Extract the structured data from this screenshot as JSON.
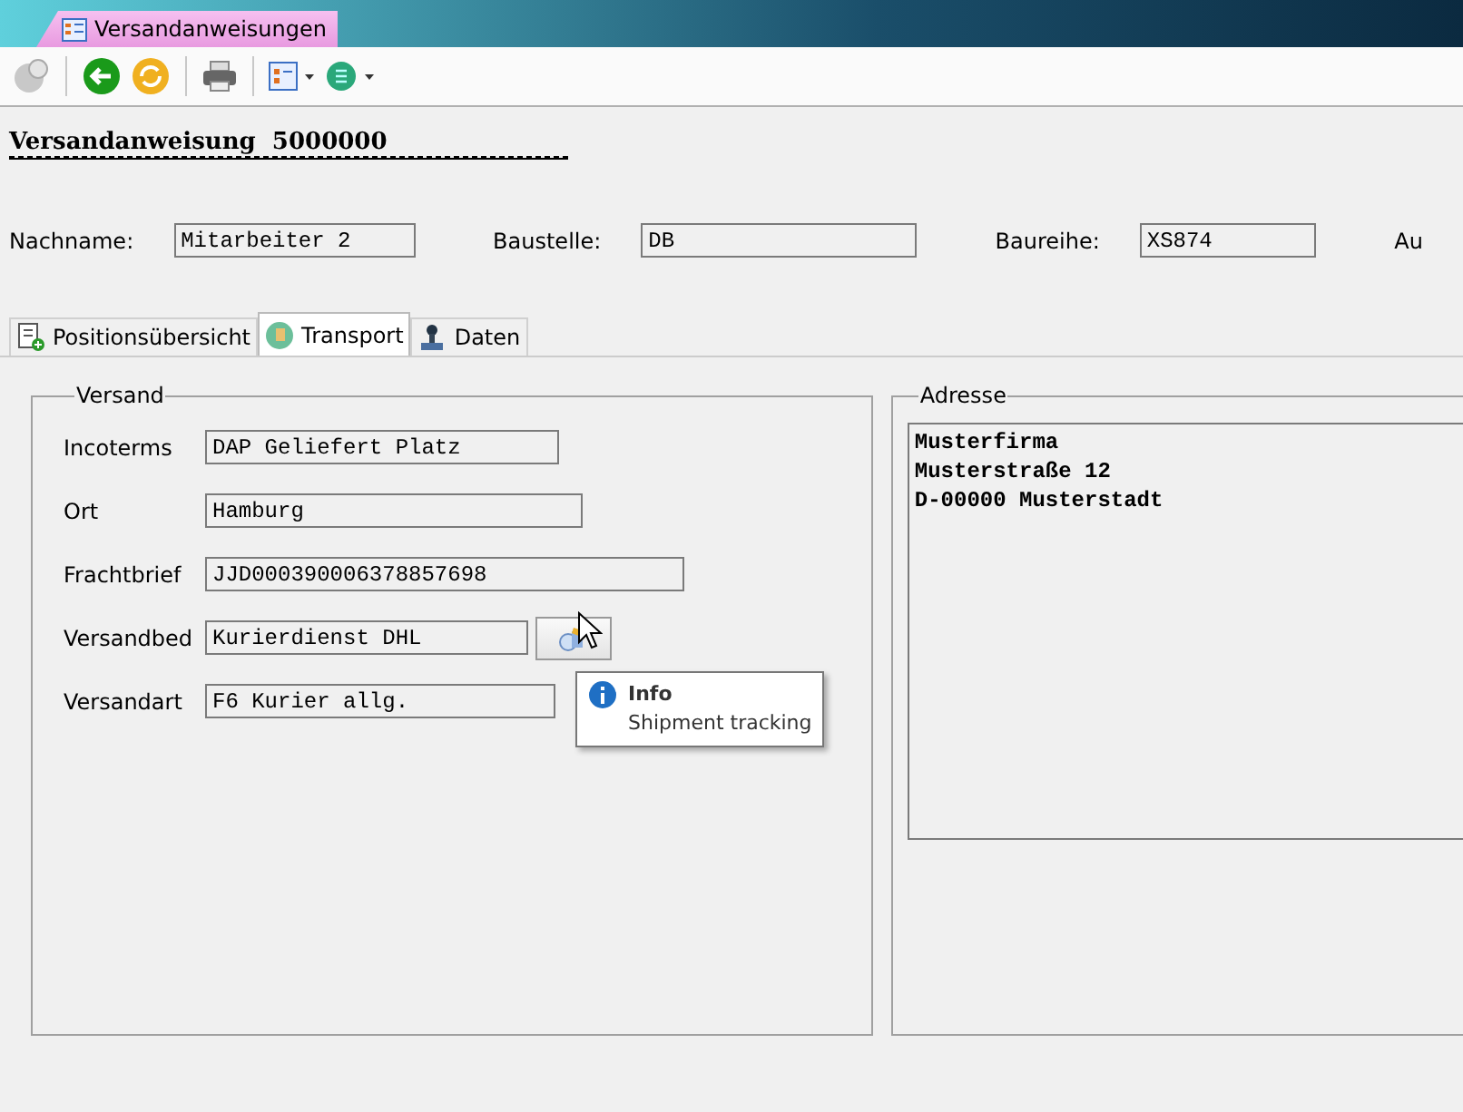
{
  "document_tab": {
    "title": "Versandanweisungen"
  },
  "title": {
    "label": "Versandanweisung",
    "number": "5000000"
  },
  "header_fields": [
    {
      "label": "Nachname:",
      "value": "Mitarbeiter 2"
    },
    {
      "label": "Baustelle:",
      "value": "DB"
    },
    {
      "label": "Baureihe:",
      "value": "XS874"
    },
    {
      "label": "Au"
    }
  ],
  "tabs": [
    {
      "label": "Positionsübersicht",
      "selected": false
    },
    {
      "label": "Transport",
      "selected": true
    },
    {
      "label": "Daten",
      "selected": false
    }
  ],
  "versand": {
    "title": "Versand",
    "fields": [
      {
        "label": "Incoterms",
        "value": "DAP Geliefert Platz"
      },
      {
        "label": "Ort",
        "value": "Hamburg"
      },
      {
        "label": "Frachtbrief",
        "value": "JJD000390006378857698"
      },
      {
        "label": "Versandbed",
        "value": "Kurierdienst DHL"
      },
      {
        "label": "Versandart",
        "value": "F6 Kurier allg."
      }
    ]
  },
  "tooltip": {
    "title": "Info",
    "text": "Shipment tracking"
  },
  "adresse": {
    "title": "Adresse",
    "lines": [
      "Musterfirma",
      "Musterstraße 12",
      "D-00000 Musterstadt"
    ]
  }
}
